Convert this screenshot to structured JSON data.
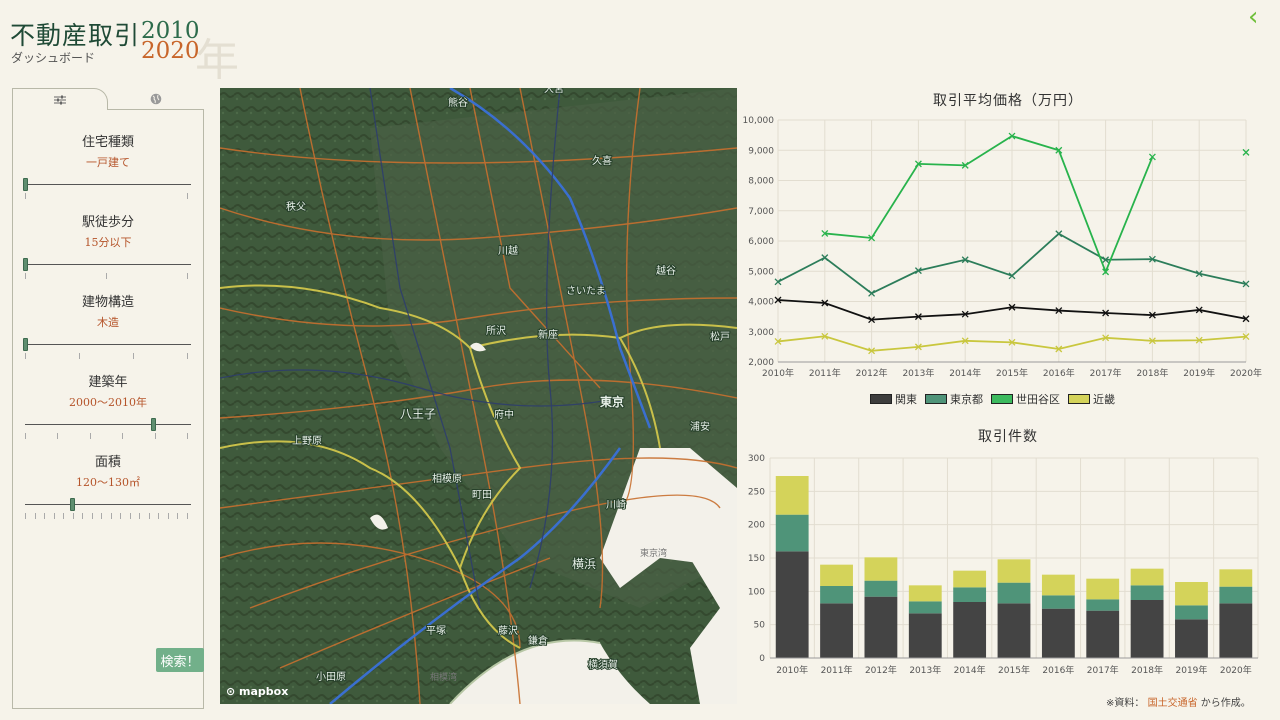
{
  "header": {
    "title": "不動産取引",
    "year_start": "2010",
    "year_end": "2020",
    "year_suffix": "年",
    "subtitle": "ダッシュボード"
  },
  "tabs": [
    {
      "name": "filters",
      "icon": "sliders-icon",
      "active": true
    },
    {
      "name": "map",
      "icon": "globe-icon",
      "active": false
    }
  ],
  "filters": [
    {
      "label": "住宅種類",
      "value": "一戸建て",
      "ticks": 2,
      "handle_pos": 0.0
    },
    {
      "label": "駅徒歩分",
      "value": "15分以下",
      "ticks": 3,
      "handle_pos": 0.0
    },
    {
      "label": "建物構造",
      "value": "木造",
      "ticks": 4,
      "handle_pos": 0.0
    },
    {
      "label": "建築年",
      "value": "2000～2010年",
      "ticks": 6,
      "handle_pos": 0.8
    },
    {
      "label": "面積",
      "value": "120～130㎡",
      "ticks": 18,
      "handle_pos": 0.294
    }
  ],
  "search_button": "検索！",
  "map": {
    "attribution": "mapbox",
    "labels": [
      "熊谷",
      "久喜",
      "秩父",
      "川越",
      "さいたま",
      "越谷",
      "所沢",
      "新座",
      "東京",
      "八王子",
      "府中",
      "町田",
      "相模原",
      "川崎",
      "横浜",
      "平塚",
      "藤沢",
      "鎌倉",
      "横須賀",
      "小田原",
      "上野原",
      "松戸",
      "浦安",
      "東京湾",
      "相模湾",
      "大宮"
    ]
  },
  "price_chart": {
    "title": "取引平均価格（万円）",
    "x": [
      "2010年",
      "2011年",
      "2012年",
      "2013年",
      "2014年",
      "2015年",
      "2016年",
      "2017年",
      "2018年",
      "2019年",
      "2020年"
    ],
    "y_ticks": [
      "2,000",
      "3,000",
      "4,000",
      "5,000",
      "6,000",
      "7,000",
      "8,000",
      "9,000",
      "10,000"
    ]
  },
  "count_chart": {
    "title": "取引件数",
    "y_ticks": [
      "0",
      "50",
      "100",
      "150",
      "200",
      "250",
      "300"
    ]
  },
  "legend": [
    {
      "name": "関東",
      "color": "#3d3d3d"
    },
    {
      "name": "東京都",
      "color": "#4f9479"
    },
    {
      "name": "世田谷区",
      "color": "#3cba5e"
    },
    {
      "name": "近畿",
      "color": "#d4d35a"
    }
  ],
  "source": {
    "prefix": "※資料：",
    "link": "国土交通省",
    "suffix": "から作成。"
  },
  "chart_data": [
    {
      "type": "line",
      "title": "取引平均価格（万円）",
      "x": [
        "2010年",
        "2011年",
        "2012年",
        "2013年",
        "2014年",
        "2015年",
        "2016年",
        "2017年",
        "2018年",
        "2019年",
        "2020年"
      ],
      "ylim": [
        2000,
        10000
      ],
      "series": [
        {
          "name": "関東",
          "color": "#111111",
          "values": [
            4050,
            3950,
            3400,
            3500,
            3580,
            3810,
            3700,
            3620,
            3550,
            3720,
            3430
          ]
        },
        {
          "name": "東京都",
          "color": "#2c7d5a",
          "values": [
            4650,
            5450,
            4270,
            5020,
            5380,
            4850,
            6240,
            5380,
            5400,
            4920,
            4580
          ]
        },
        {
          "name": "世田谷区",
          "color": "#28b34c",
          "values": [
            null,
            6250,
            6100,
            8550,
            8500,
            9470,
            9000,
            4980,
            8780,
            null,
            8930
          ]
        },
        {
          "name": "近畿",
          "color": "#c9c73e",
          "values": [
            2680,
            2850,
            2370,
            2500,
            2700,
            2650,
            2430,
            2800,
            2700,
            2720,
            2840
          ]
        }
      ]
    },
    {
      "type": "bar",
      "title": "取引件数",
      "categories": [
        "2010年",
        "2011年",
        "2012年",
        "2013年",
        "2014年",
        "2015年",
        "2016年",
        "2017年",
        "2018年",
        "2019年",
        "2020年"
      ],
      "ylim": [
        0,
        300
      ],
      "stacked": true,
      "series": [
        {
          "name": "関東",
          "color": "#444444",
          "values": [
            160,
            82,
            92,
            67,
            84,
            82,
            74,
            71,
            87,
            58,
            82
          ]
        },
        {
          "name": "東京都",
          "color": "#4f9479",
          "values": [
            55,
            26,
            24,
            18,
            22,
            31,
            20,
            17,
            22,
            21,
            25
          ]
        },
        {
          "name": "近畿",
          "color": "#d4d35a",
          "values": [
            58,
            32,
            35,
            24,
            25,
            35,
            31,
            31,
            25,
            35,
            26
          ]
        }
      ]
    }
  ]
}
